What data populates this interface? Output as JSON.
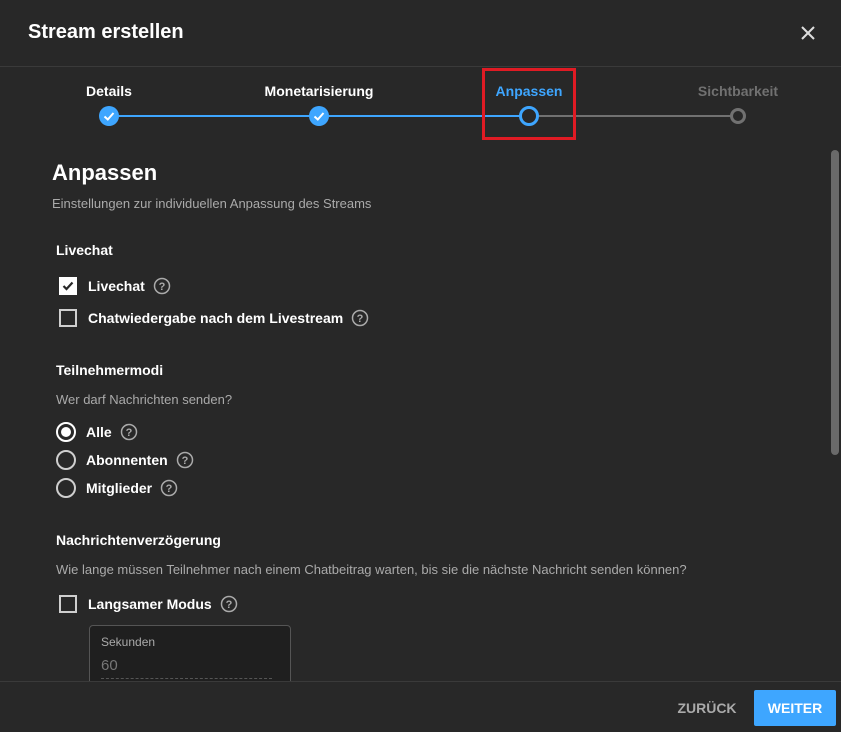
{
  "dialog": {
    "title": "Stream erstellen",
    "close_icon": "close-icon"
  },
  "stepper": {
    "steps": [
      {
        "label": "Details",
        "state": "completed"
      },
      {
        "label": "Monetarisierung",
        "state": "completed"
      },
      {
        "label": "Anpassen",
        "state": "current"
      },
      {
        "label": "Sichtbarkeit",
        "state": "upcoming"
      }
    ]
  },
  "colors": {
    "accent": "#3ea6ff",
    "background": "#282828",
    "highlight": "#e01b24",
    "inactive": "#717171"
  },
  "page": {
    "title": "Anpassen",
    "subtitle": "Einstellungen zur individuellen Anpassung des Streams"
  },
  "livechat": {
    "heading": "Livechat",
    "options": [
      {
        "label": "Livechat",
        "checked": true
      },
      {
        "label": "Chatwiedergabe nach dem Livestream",
        "checked": false
      }
    ]
  },
  "participants": {
    "heading": "Teilnehmermodi",
    "question": "Wer darf Nachrichten senden?",
    "options": [
      {
        "label": "Alle",
        "selected": true
      },
      {
        "label": "Abonnenten",
        "selected": false
      },
      {
        "label": "Mitglieder",
        "selected": false
      }
    ]
  },
  "delay": {
    "heading": "Nachrichtenverzögerung",
    "question": "Wie lange müssen Teilnehmer nach einem Chatbeitrag warten, bis sie die nächste Nachricht senden können?",
    "slow_mode_label": "Langsamer Modus",
    "slow_mode_checked": false,
    "seconds_label": "Sekunden",
    "seconds_value": "60"
  },
  "footer": {
    "back_label": "ZURÜCK",
    "next_label": "WEITER"
  }
}
